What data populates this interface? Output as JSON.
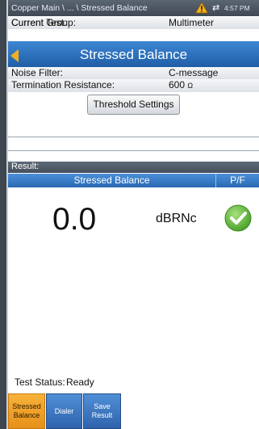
{
  "status_bar": {
    "breadcrumb": "Copper Main \\ ... \\ Stressed Balance",
    "time": "4:57 PM",
    "icons": [
      "warning-icon",
      "network-icon",
      "battery-icon"
    ]
  },
  "current_group": {
    "label": "Current Group:",
    "value": "Multimeter"
  },
  "current_test": {
    "label": "Current Test:",
    "value": "Stressed Balance"
  },
  "noise_filter": {
    "label": "Noise Filter:",
    "value": "C-message"
  },
  "termination_resistance": {
    "label": "Termination Resistance:",
    "value": "600",
    "unit": "Ω"
  },
  "threshold_button": "Threshold Settings",
  "result": {
    "header": "Result:",
    "columns": [
      "Stressed Balance",
      "P/F"
    ],
    "value": "0.0",
    "unit": "dBRNc",
    "pass_fail": "pass"
  },
  "test_status": {
    "label": "Test Status:",
    "value": "Ready"
  },
  "softkeys": [
    {
      "label": "Stressed Balance",
      "active": true
    },
    {
      "label": "Dialer",
      "active": false
    },
    {
      "label": "Save Result",
      "active": false
    }
  ],
  "colors": {
    "accent_blue": "#2f6fbf",
    "active_orange": "#f0a52a",
    "pass_green": "#6cc04a"
  }
}
